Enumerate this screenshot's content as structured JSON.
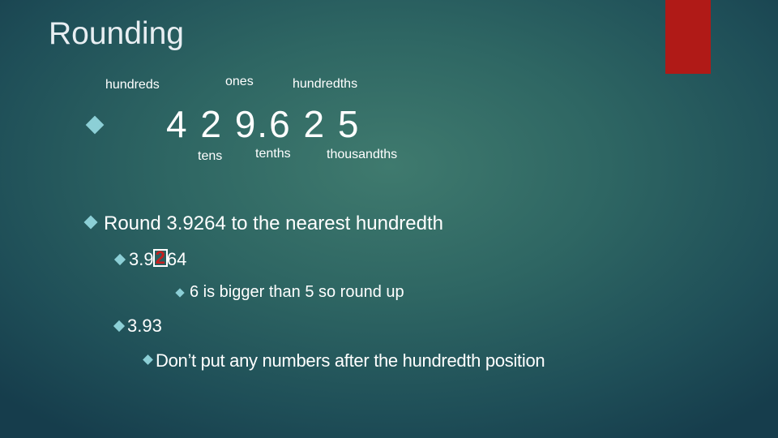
{
  "slide": {
    "title": "Rounding",
    "accent_color": "#b01a17",
    "bullet_color": "#8ccfd6",
    "place_value_labels": {
      "hundreds": "hundreds",
      "ones": "ones",
      "hundredths": "hundredths",
      "tens": "tens",
      "tenths": "tenths",
      "thousandths": "thousandths"
    },
    "example_number": "4 2 9.6 2 5",
    "bullets": [
      {
        "level": 1,
        "text": "Round 3.9264 to the nearest hundredth"
      },
      {
        "level": 2,
        "prefix": "3.9",
        "highlight": "2",
        "suffix": "64"
      },
      {
        "level": 3,
        "text": "6 is bigger than 5 so round up"
      },
      {
        "level": 2,
        "text": "3.93"
      },
      {
        "level": 3,
        "text": "Don’t put any numbers after the hundredth position"
      }
    ]
  }
}
